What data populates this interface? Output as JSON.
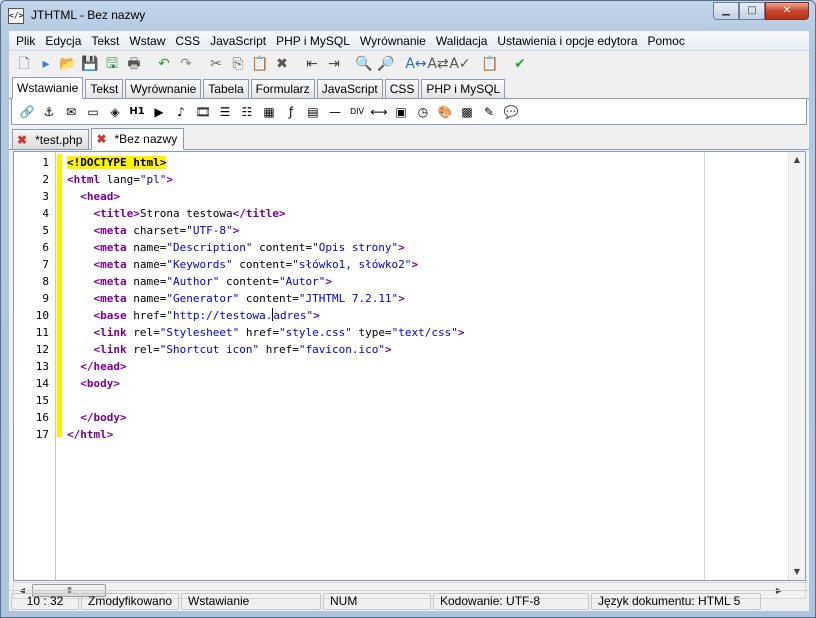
{
  "window": {
    "title": "JTHTML - Bez nazwy",
    "app_icon_glyph": "</>",
    "controls": {
      "minimize": "▁",
      "maximize": "□",
      "close": "✕"
    }
  },
  "menu": [
    "Plik",
    "Edycja",
    "Tekst",
    "Wstaw",
    "CSS",
    "JavaScript",
    "PHP i MySQL",
    "Wyrównanie",
    "Walidacja",
    "Ustawienia i opcje edytora",
    "Pomoc"
  ],
  "toolbar": [
    {
      "name": "new-document-icon",
      "glyph": "🗋",
      "color": "#5a6a82"
    },
    {
      "name": "new-from-template-icon",
      "glyph": "▸",
      "color": "#3c7ad6"
    },
    {
      "name": "open-folder-icon",
      "glyph": "📂",
      "color": "#e0a82c"
    },
    {
      "name": "save-icon",
      "glyph": "💾",
      "color": "#2f5fb0"
    },
    {
      "name": "save-all-icon",
      "glyph": "🖫",
      "color": "#2f8a3c"
    },
    {
      "name": "print-icon",
      "glyph": "🖶",
      "color": "#555555"
    },
    {
      "name": "undo-icon",
      "glyph": "↶",
      "color": "#2f9a3a"
    },
    {
      "name": "redo-icon",
      "glyph": "↷",
      "color": "#888888"
    },
    {
      "name": "cut-icon",
      "glyph": "✂",
      "color": "#666666"
    },
    {
      "name": "copy-icon",
      "glyph": "⎘",
      "color": "#666666"
    },
    {
      "name": "paste-icon",
      "glyph": "📋",
      "color": "#b4792a"
    },
    {
      "name": "delete-icon",
      "glyph": "✖",
      "color": "#555555"
    },
    {
      "name": "indent-decrease-icon",
      "glyph": "⇤",
      "color": "#444444"
    },
    {
      "name": "indent-increase-icon",
      "glyph": "⇥",
      "color": "#444444"
    },
    {
      "name": "find-icon",
      "glyph": "🔍",
      "color": "#444444"
    },
    {
      "name": "find-next-icon",
      "glyph": "🔎",
      "color": "#444444"
    },
    {
      "name": "replace-icon",
      "glyph": "A↔",
      "color": "#2f6fb8"
    },
    {
      "name": "replace-all-icon",
      "glyph": "A⇄",
      "color": "#555555"
    },
    {
      "name": "spellcheck-icon",
      "glyph": "A✓",
      "color": "#555555"
    },
    {
      "name": "clipboard-history-icon",
      "glyph": "📋",
      "color": "#c89a3a"
    },
    {
      "name": "validate-check-icon",
      "glyph": "✔",
      "color": "#2fa52f"
    }
  ],
  "palette_tabs": [
    "Wstawianie",
    "Tekst",
    "Wyrównanie",
    "Tabela",
    "Formularz",
    "JavaScript",
    "CSS",
    "PHP i MySQL"
  ],
  "palette_active": "Wstawianie",
  "palette": [
    {
      "name": "link-icon",
      "glyph": "🔗"
    },
    {
      "name": "anchor-icon",
      "glyph": "⚓"
    },
    {
      "name": "email-icon",
      "glyph": "✉"
    },
    {
      "name": "image-icon",
      "glyph": "▭"
    },
    {
      "name": "image-map-icon",
      "glyph": "◈"
    },
    {
      "name": "heading-h1-icon",
      "glyph": "H1"
    },
    {
      "name": "media-play-icon",
      "glyph": "▶"
    },
    {
      "name": "audio-note-icon",
      "glyph": "♪"
    },
    {
      "name": "video-film-icon",
      "glyph": "🎞"
    },
    {
      "name": "ordered-list-icon",
      "glyph": "☰"
    },
    {
      "name": "unordered-list-icon",
      "glyph": "☷"
    },
    {
      "name": "table-icon",
      "glyph": "▦"
    },
    {
      "name": "flash-object-icon",
      "glyph": "ƒ"
    },
    {
      "name": "form-icon",
      "glyph": "▤"
    },
    {
      "name": "horizontal-rule-icon",
      "glyph": "—"
    },
    {
      "name": "div-icon",
      "glyph": "DIV"
    },
    {
      "name": "marquee-icon",
      "glyph": "⟷"
    },
    {
      "name": "frame-icon",
      "glyph": "▣"
    },
    {
      "name": "clock-icon",
      "glyph": "◷"
    },
    {
      "name": "color-palette-icon",
      "glyph": "🎨"
    },
    {
      "name": "color-grid-icon",
      "glyph": "▩"
    },
    {
      "name": "eyedropper-icon",
      "glyph": "✎"
    },
    {
      "name": "comment-bubble-icon",
      "glyph": "💬"
    }
  ],
  "document_tabs": [
    {
      "label": "*test.php",
      "active": false
    },
    {
      "label": "*Bez nazwy",
      "active": true
    }
  ],
  "doc_tab_close_glyph": "✖",
  "editor": {
    "lines": [
      [
        {
          "c": "doctype",
          "t": "<!DOCTYPE html>"
        }
      ],
      [
        {
          "c": "t",
          "t": "<html "
        },
        {
          "c": "a",
          "t": "lang="
        },
        {
          "c": "v",
          "t": "\"pl\""
        },
        {
          "c": "t",
          "t": ">"
        }
      ],
      [
        {
          "c": "a",
          "t": "  "
        },
        {
          "c": "t",
          "t": "<head>"
        }
      ],
      [
        {
          "c": "a",
          "t": "    "
        },
        {
          "c": "t",
          "t": "<title>"
        },
        {
          "c": "a",
          "t": "Strona testowa"
        },
        {
          "c": "t",
          "t": "</title>"
        }
      ],
      [
        {
          "c": "a",
          "t": "    "
        },
        {
          "c": "t",
          "t": "<meta "
        },
        {
          "c": "a",
          "t": "charset="
        },
        {
          "c": "v",
          "t": "\"UTF-8\""
        },
        {
          "c": "t",
          "t": ">"
        }
      ],
      [
        {
          "c": "a",
          "t": "    "
        },
        {
          "c": "t",
          "t": "<meta "
        },
        {
          "c": "a",
          "t": "name="
        },
        {
          "c": "v",
          "t": "\"Description\""
        },
        {
          "c": "a",
          "t": " content="
        },
        {
          "c": "v",
          "t": "\"Opis strony\""
        },
        {
          "c": "t",
          "t": ">"
        }
      ],
      [
        {
          "c": "a",
          "t": "    "
        },
        {
          "c": "t",
          "t": "<meta "
        },
        {
          "c": "a",
          "t": "name="
        },
        {
          "c": "v",
          "t": "\"Keywords\""
        },
        {
          "c": "a",
          "t": " content="
        },
        {
          "c": "v",
          "t": "\"słówko1, słówko2\""
        },
        {
          "c": "t",
          "t": ">"
        }
      ],
      [
        {
          "c": "a",
          "t": "    "
        },
        {
          "c": "t",
          "t": "<meta "
        },
        {
          "c": "a",
          "t": "name="
        },
        {
          "c": "v",
          "t": "\"Author\""
        },
        {
          "c": "a",
          "t": " content="
        },
        {
          "c": "v",
          "t": "\"Autor\""
        },
        {
          "c": "t",
          "t": ">"
        }
      ],
      [
        {
          "c": "a",
          "t": "    "
        },
        {
          "c": "t",
          "t": "<meta "
        },
        {
          "c": "a",
          "t": "name="
        },
        {
          "c": "v",
          "t": "\"Generator\""
        },
        {
          "c": "a",
          "t": " content="
        },
        {
          "c": "v",
          "t": "\"JTHTML 7.2.11\""
        },
        {
          "c": "t",
          "t": ">"
        }
      ],
      [
        {
          "c": "a",
          "t": "    "
        },
        {
          "c": "t",
          "t": "<base "
        },
        {
          "c": "a",
          "t": "href="
        },
        {
          "c": "v",
          "t": "\"http://testowa."
        },
        {
          "c": "caret",
          "t": ""
        },
        {
          "c": "v",
          "t": "adres\""
        },
        {
          "c": "t",
          "t": ">"
        }
      ],
      [
        {
          "c": "a",
          "t": "    "
        },
        {
          "c": "t",
          "t": "<link "
        },
        {
          "c": "a",
          "t": "rel="
        },
        {
          "c": "v",
          "t": "\"Stylesheet\""
        },
        {
          "c": "a",
          "t": " href="
        },
        {
          "c": "v",
          "t": "\"style.css\""
        },
        {
          "c": "a",
          "t": " type="
        },
        {
          "c": "v",
          "t": "\"text/css\""
        },
        {
          "c": "t",
          "t": ">"
        }
      ],
      [
        {
          "c": "a",
          "t": "    "
        },
        {
          "c": "t",
          "t": "<link "
        },
        {
          "c": "a",
          "t": "rel="
        },
        {
          "c": "v",
          "t": "\"Shortcut icon\""
        },
        {
          "c": "a",
          "t": " href="
        },
        {
          "c": "v",
          "t": "\"favicon.ico\""
        },
        {
          "c": "t",
          "t": ">"
        }
      ],
      [
        {
          "c": "a",
          "t": "  "
        },
        {
          "c": "t",
          "t": "</head>"
        }
      ],
      [
        {
          "c": "a",
          "t": "  "
        },
        {
          "c": "t",
          "t": "<body>"
        }
      ],
      [],
      [
        {
          "c": "a",
          "t": "  "
        },
        {
          "c": "t",
          "t": "</body>"
        }
      ],
      [
        {
          "c": "t",
          "t": "</html>"
        }
      ]
    ]
  },
  "hscroll_thumb_glyph": "III",
  "scroll_arrows": {
    "up": "▲",
    "down": "▼",
    "left": "◀",
    "right": "▶"
  },
  "status": {
    "position": "10 : 32",
    "modified": "Zmodyfikowano",
    "mode": "Wstawianie",
    "num": "NUM",
    "encoding": "Kodowanie: UTF-8",
    "doc_language": "Język dokumentu: HTML 5"
  },
  "colors": {
    "tag": "#7a0098",
    "value": "#0000dd",
    "highlight": "#fff200",
    "close_button": "#c7452d"
  }
}
